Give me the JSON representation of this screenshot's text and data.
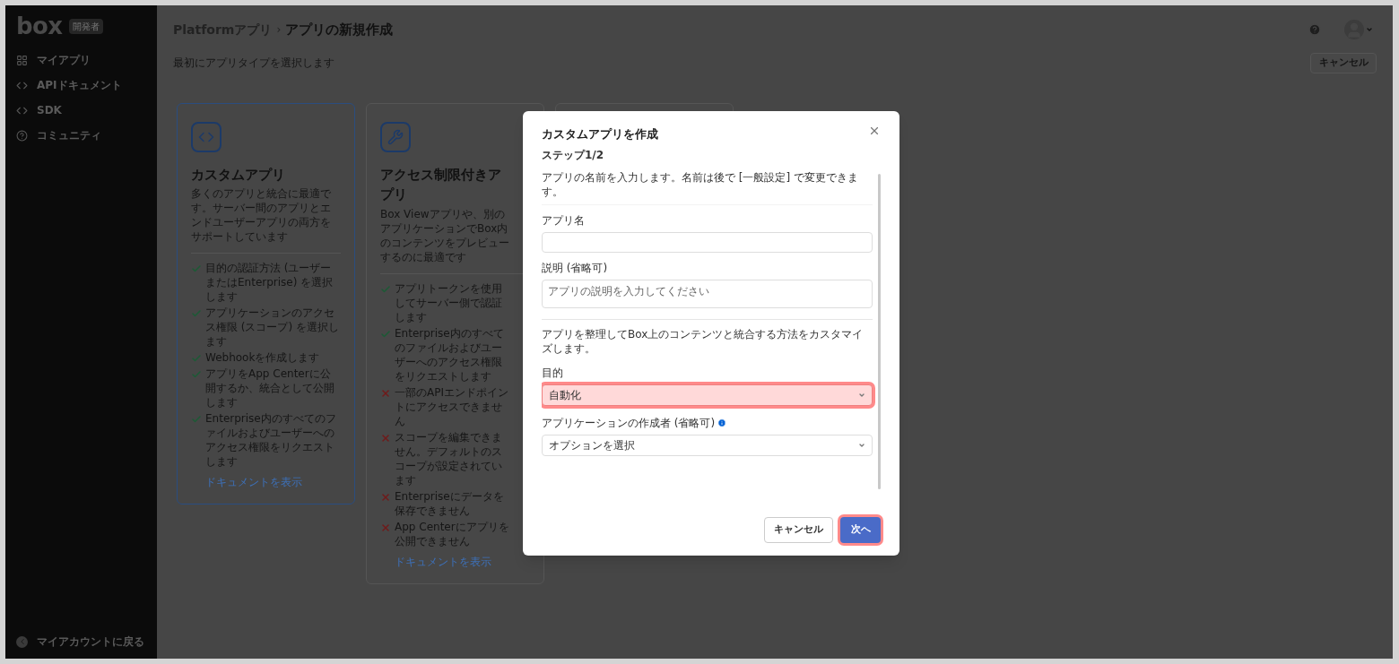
{
  "sidebar": {
    "logo": "box",
    "badge": "開発者",
    "items": [
      {
        "label": "マイアプリ"
      },
      {
        "label": "APIドキュメント"
      },
      {
        "label": "SDK"
      },
      {
        "label": "コミュニティ"
      }
    ],
    "footer": "マイアカウントに戻る"
  },
  "header": {
    "breadcrumb": "Platformアプリ",
    "separator": "›",
    "title": "アプリの新規作成"
  },
  "subtitle": "最初にアプリタイプを選択します",
  "cancel_button": "キャンセル",
  "cards": [
    {
      "selected": true,
      "title": "カスタムアプリ",
      "description": "多くのアプリと統合に最適です。サーバー間のアプリとエンドユーザーアプリの両方をサポートしています",
      "features": [
        {
          "ok": true,
          "text": "目的の認証方法 (ユーザーまたはEnterprise) を選択します"
        },
        {
          "ok": true,
          "text": "アプリケーションのアクセス権限 (スコープ) を選択します"
        },
        {
          "ok": true,
          "text": "Webhookを作成します"
        },
        {
          "ok": true,
          "text": "アプリをApp Centerに公開するか、統合として公開します"
        },
        {
          "ok": true,
          "text": "Enterprise内のすべてのファイルおよびユーザーへのアクセス権限をリクエストします"
        }
      ],
      "link": "ドキュメントを表示"
    },
    {
      "selected": false,
      "title": "アクセス制限付きアプリ",
      "description": "Box Viewアプリや、別のアプリケーションでBox内のコンテンツをプレビューするのに最適です",
      "features": [
        {
          "ok": true,
          "text": "アプリトークンを使用してサーバー側で認証します"
        },
        {
          "ok": true,
          "text": "Enterprise内のすべてのファイルおよびユーザーへのアクセス権限をリクエストします"
        },
        {
          "ok": false,
          "text": "一部のAPIエンドポイントにアクセスできません"
        },
        {
          "ok": false,
          "text": "スコープを編集できません。デフォルトのスコープが設定されています"
        },
        {
          "ok": false,
          "text": "Enterpriseにデータを保存できません"
        },
        {
          "ok": false,
          "text": "App Centerにアプリを公開できません"
        }
      ],
      "link": "ドキュメントを表示"
    },
    {
      "selected": false
    }
  ],
  "modal": {
    "title": "カスタムアプリを作成",
    "step": "ステップ1/2",
    "intro": "アプリの名前を入力します。名前は後で [一般設定] で変更できます。",
    "fields": [
      {
        "kind": "text",
        "label": "アプリ名"
      },
      {
        "kind": "textarea",
        "label": "説明 (省略可)",
        "placeholder": "アプリの説明を入力してください"
      }
    ],
    "section_text": "アプリを整理してBox上のコンテンツと統合する方法をカスタマイズします。",
    "selects": [
      {
        "label": "目的",
        "value": "自動化",
        "highlighted": true,
        "info": false
      },
      {
        "label": "アプリケーションの作成者 (省略可)",
        "value": "オプションを選択",
        "highlighted": false,
        "info": true
      }
    ],
    "buttons": [
      {
        "kind": "secondary",
        "label": "キャンセル",
        "highlighted": false
      },
      {
        "kind": "primary",
        "label": "次へ",
        "highlighted": true
      }
    ]
  }
}
